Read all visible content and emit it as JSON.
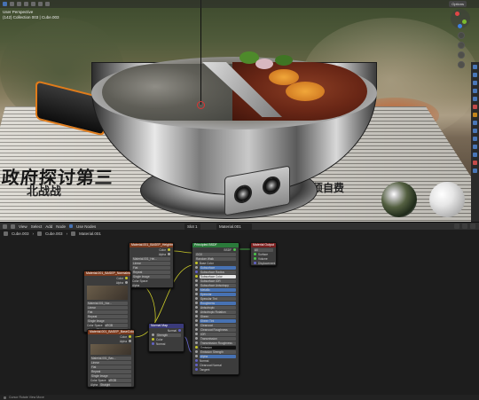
{
  "viewport": {
    "perspective_label": "User Perspective",
    "object_info": "(142) Collection 003 | Cube.003",
    "options_label": "Options",
    "newspaper_headline": "政府探讨第三",
    "newspaper_sub": "北战战",
    "newspaper_right": "介须自费"
  },
  "node_editor": {
    "header": {
      "menus": [
        "View",
        "Select",
        "Add",
        "Node"
      ],
      "use_nodes_label": "Use Nodes",
      "slot_label": "Slot 1",
      "material_label": "Material.001"
    },
    "breadcrumb": [
      "Cube.003",
      "Cube.003",
      "Material.001"
    ],
    "nodes": {
      "image_top": {
        "title": "Material.001_BASEP_Heightmap",
        "rows": [
          "Color",
          "Alpha",
          "Material.001_Hei...",
          "Linear",
          "Flat",
          "Repeat",
          "Single Image",
          "Color Space",
          "Alpha"
        ]
      },
      "image_mid": {
        "title": "Material.001_BASEP_Normalmap",
        "rows": [
          "Color",
          "Alpha",
          "Material.001_Nor...",
          "Linear",
          "Flat",
          "Repeat",
          "Single Image",
          "Color Space",
          "Alpha"
        ],
        "color_space": "sRGB",
        "alpha": "Straight"
      },
      "image_bot": {
        "title": "Material.001_BASEP_BaseColor",
        "rows": [
          "Color",
          "Alpha",
          "Material.001_Bas...",
          "Linear",
          "Flat",
          "Repeat",
          "Single Image",
          "Color Space",
          "Alpha"
        ],
        "color_space": "sRGB",
        "alpha": "Straight"
      },
      "vector": {
        "title": "Normal Map",
        "rows": [
          "Normal",
          "Strength",
          "Color",
          "Normal"
        ]
      },
      "bsdf": {
        "title": "Principled BSDF",
        "rows": [
          "BSDF",
          "GGX",
          "Random Walk",
          "Base Color",
          "Subsurface",
          "Subsurface Radius",
          "Subsurface Color",
          "Subsurface IOR",
          "Subsurface Anisotropy",
          "Metallic",
          "Specular",
          "Specular Tint",
          "Roughness",
          "Anisotropic",
          "Anisotropic Rotation",
          "Sheen",
          "Sheen Tint",
          "Clearcoat",
          "Clearcoat Roughness",
          "IOR",
          "Transmission",
          "Transmission Roughness",
          "Emission",
          "Emission Strength",
          "Alpha",
          "Normal",
          "Clearcoat Normal",
          "Tangent"
        ]
      },
      "output": {
        "title": "Material Output",
        "rows": [
          "All",
          "Surface",
          "Volume",
          "Displacement"
        ]
      }
    }
  },
  "status_bar": {
    "text": "Cursor  Rotate View  Move"
  }
}
